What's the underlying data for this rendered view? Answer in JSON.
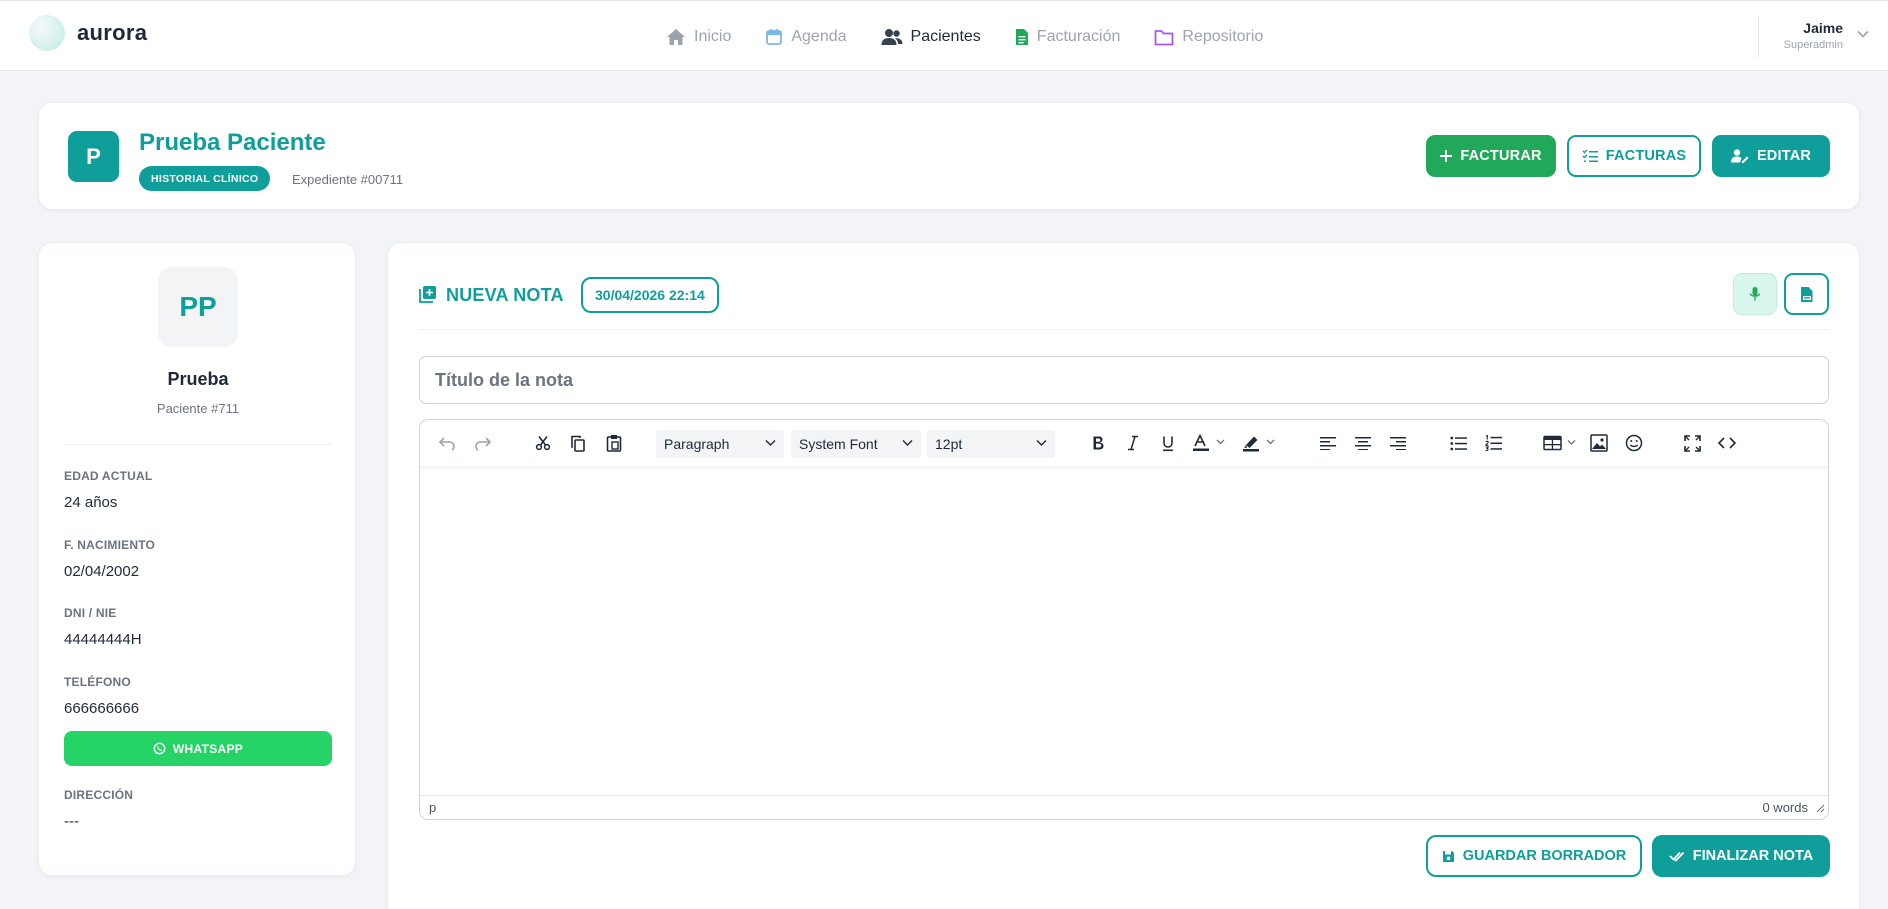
{
  "app": {
    "logo_text": "aurora"
  },
  "nav": {
    "items": [
      {
        "label": "Inicio",
        "icon": "home-icon",
        "color": "#9ca3af"
      },
      {
        "label": "Agenda",
        "icon": "calendar-icon",
        "color": "#7ab8e8"
      },
      {
        "label": "Pacientes",
        "icon": "users-icon",
        "color": "#374151"
      },
      {
        "label": "Facturación",
        "icon": "invoice-icon",
        "color": "#22a85a"
      },
      {
        "label": "Repositorio",
        "icon": "folder-icon",
        "color": "#a855f7"
      }
    ],
    "active": "Pacientes"
  },
  "user": {
    "name": "Jaime",
    "role": "Superadmin"
  },
  "patient": {
    "initial": "P",
    "name": "Prueba Paciente",
    "badge": "HISTORIAL CLÍNICO",
    "expediente": "Expediente #00711"
  },
  "actions": {
    "facturar": "FACTURAR",
    "facturas": "FACTURAS",
    "editar": "EDITAR"
  },
  "sidebar": {
    "initials": "PP",
    "first_name": "Prueba",
    "patient_number": "Paciente #711",
    "fields": {
      "edad_label": "EDAD ACTUAL",
      "edad_value": "24 años",
      "nacimiento_label": "F. NACIMIENTO",
      "nacimiento_value": "02/04/2002",
      "dni_label": "DNI / NIE",
      "dni_value": "44444444H",
      "telefono_label": "TELÉFONO",
      "telefono_value": "666666666",
      "direccion_label": "DIRECCIÓN",
      "direccion_value": "---"
    },
    "whatsapp": "WHATSAPP"
  },
  "note": {
    "title": "NUEVA NOTA",
    "datetime": "30/04/2026 22:14",
    "title_placeholder": "Título de la nota",
    "toolbar": {
      "block_format": "Paragraph",
      "font_family": "System Font",
      "font_size": "12pt"
    },
    "status_path": "p",
    "word_count": "0 words",
    "save_draft": "GUARDAR BORRADOR",
    "finalize": "FINALIZAR NOTA"
  },
  "colors": {
    "primary": "#0f9e9a",
    "success": "#22a85a",
    "whatsapp": "#25d366"
  }
}
